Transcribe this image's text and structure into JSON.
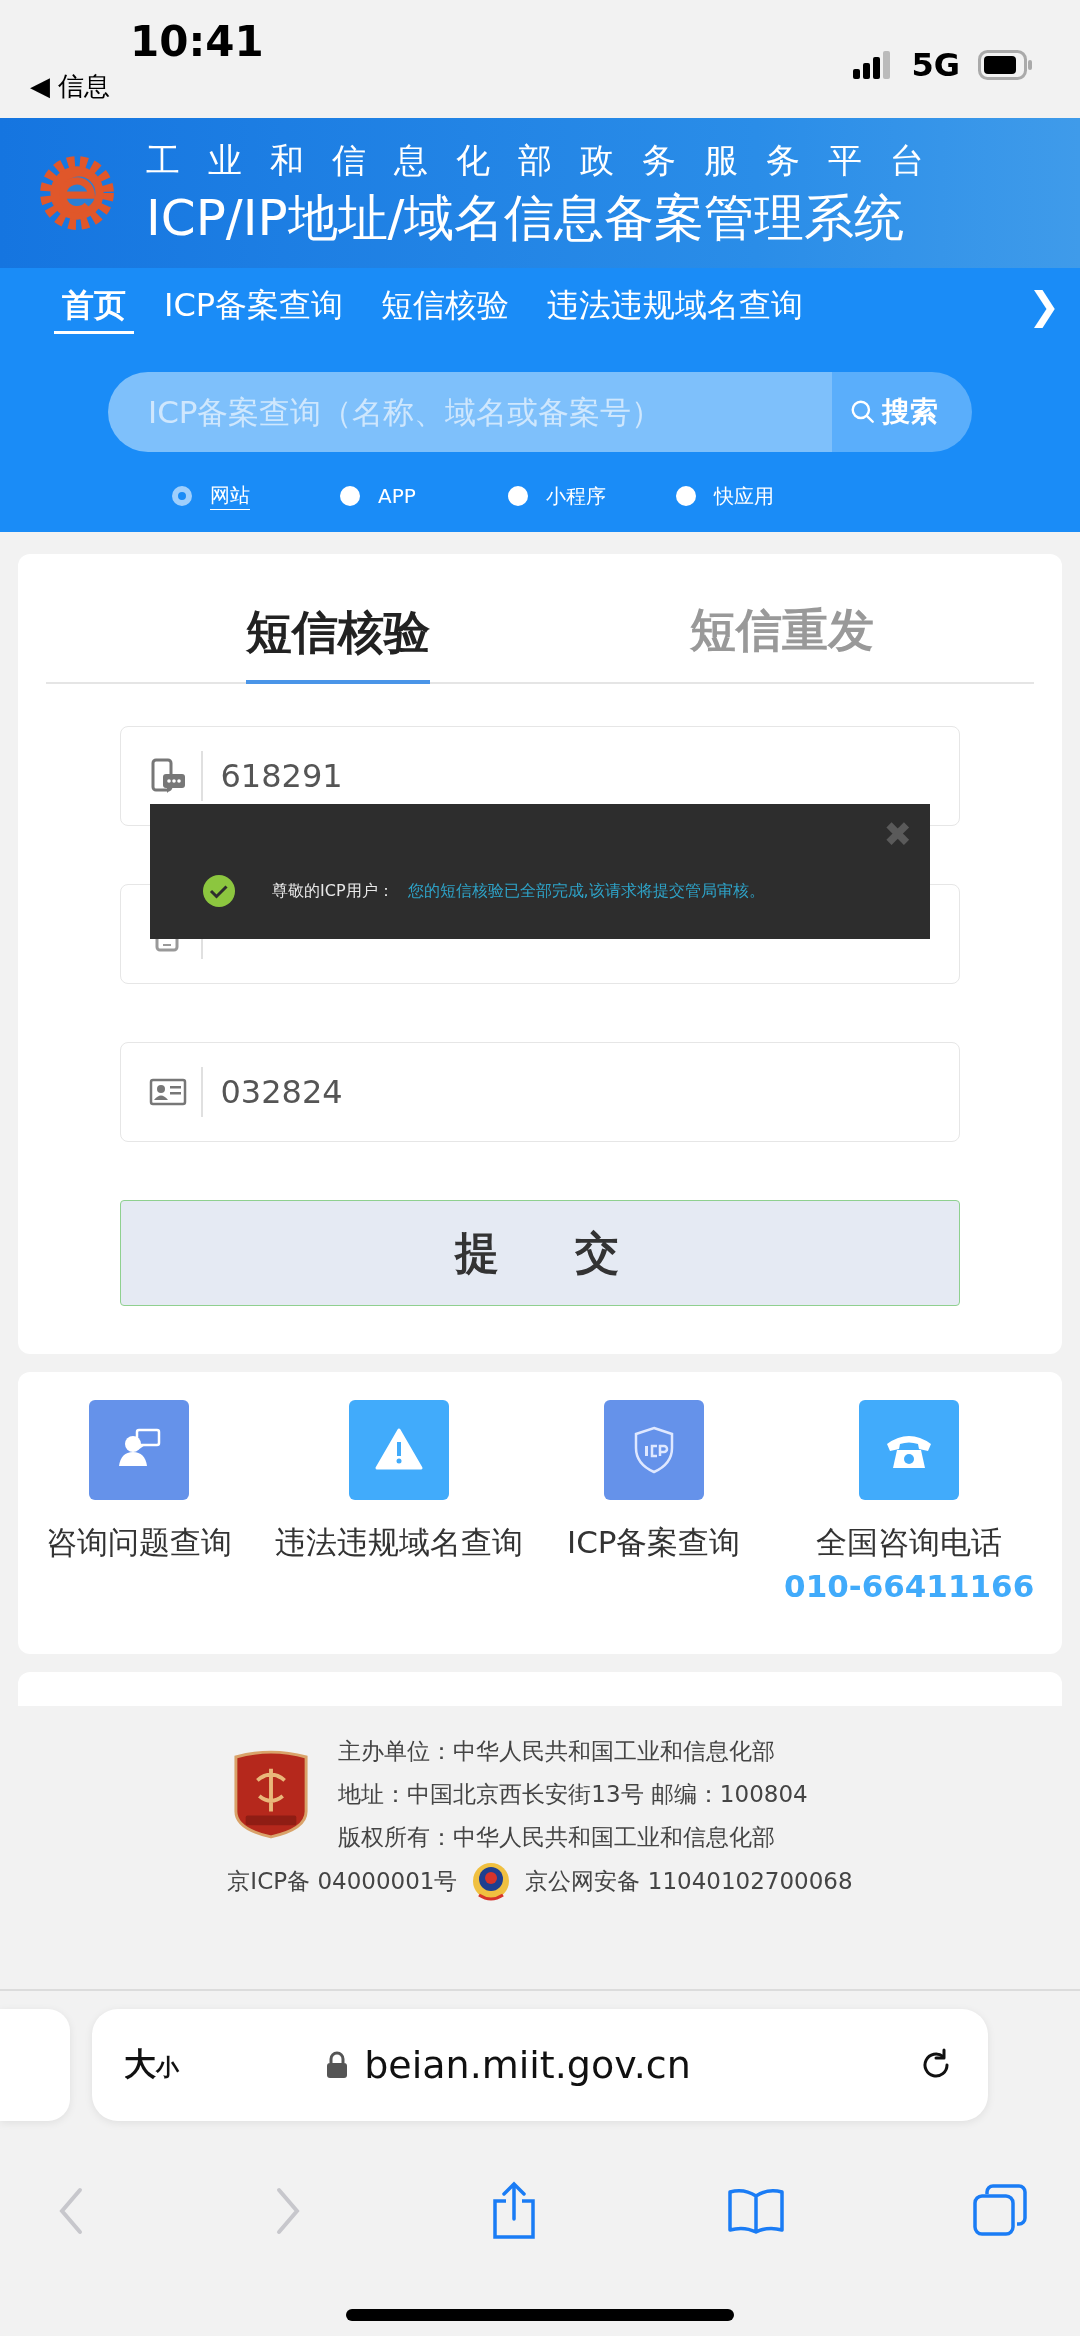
{
  "status_bar": {
    "time": "10:41",
    "back_label": "◀ 信息",
    "network": "5G"
  },
  "header": {
    "platform": "工业和信息化部政务服务平台",
    "system": "ICP/IP地址/域名信息备案管理系统"
  },
  "nav": {
    "items": [
      {
        "label": "首页",
        "selected": true
      },
      {
        "label": "ICP备案查询",
        "selected": false
      },
      {
        "label": "短信核验",
        "selected": false
      },
      {
        "label": "违法违规域名查询",
        "selected": false
      }
    ],
    "more": "❯"
  },
  "search": {
    "placeholder": "ICP备案查询（名称、域名或备案号）",
    "button": "搜索"
  },
  "search_types": [
    {
      "label": "网站",
      "selected": true
    },
    {
      "label": "APP",
      "selected": false
    },
    {
      "label": "小程序",
      "selected": false
    },
    {
      "label": "快应用",
      "selected": false
    }
  ],
  "form_tabs": [
    {
      "label": "短信核验",
      "selected": true
    },
    {
      "label": "短信重发",
      "selected": false
    }
  ],
  "fields": [
    {
      "kind": "code",
      "value": "618291"
    },
    {
      "kind": "phone"
    },
    {
      "kind": "id",
      "value": "032824"
    }
  ],
  "submit": "提 交",
  "toast": {
    "lead": "尊敬的ICP用户：",
    "message": "您的短信核验已全部完成,该请求将提交管局审核。",
    "close": "✖"
  },
  "shortcuts": [
    {
      "kind": "consult",
      "label": "咨询问题查询",
      "color": "#6592ea"
    },
    {
      "kind": "warning",
      "label": "违法违规域名查询",
      "color": "#41abfb"
    },
    {
      "kind": "icp",
      "label": "ICP备案查询",
      "color": "#6592ea"
    },
    {
      "kind": "phone",
      "label": "全国咨询电话",
      "color": "#41abfb",
      "number": "010-66411166"
    }
  ],
  "footer": {
    "lines": [
      "主办单位：中华人民共和国工业和信息化部",
      "地址：中国北京西长安街13号 邮编：100804",
      "版权所有：中华人民共和国工业和信息化部"
    ],
    "icp": "京ICP备 04000001号",
    "police": "京公网安备 11040102700068"
  },
  "browser": {
    "size_label": [
      "大",
      "小"
    ],
    "url": "beian.miit.gov.cn"
  }
}
